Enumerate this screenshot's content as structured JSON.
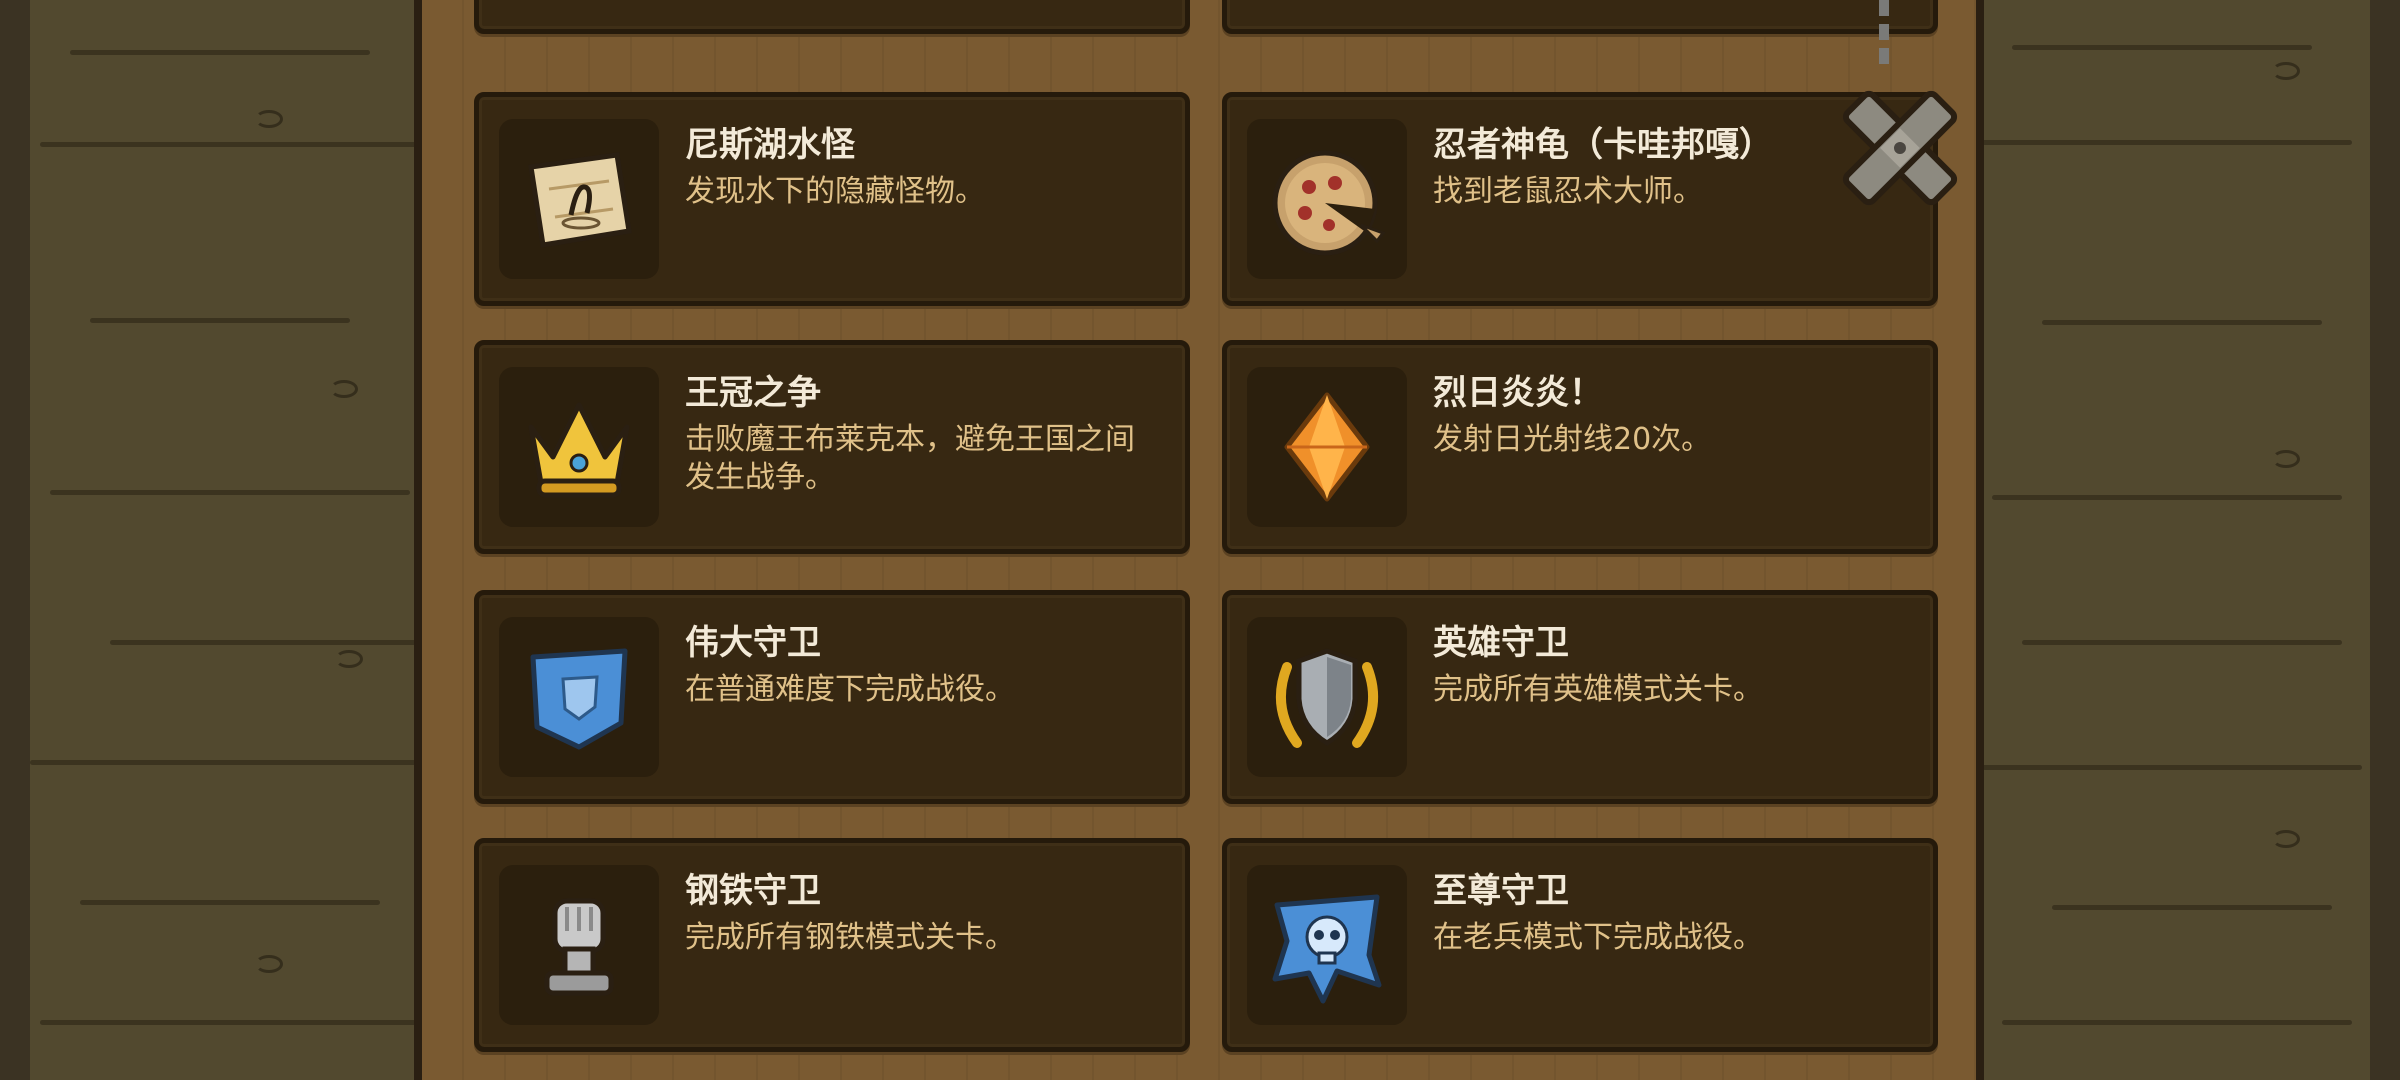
{
  "achievements": [
    {
      "title": "尼斯湖水怪",
      "desc": "发现水下的隐藏怪物。",
      "icon": "lake-map-icon"
    },
    {
      "title": "忍者神龟（卡哇邦嘎）",
      "desc": "找到老鼠忍术大师。",
      "icon": "pizza-icon"
    },
    {
      "title": "王冠之争",
      "desc": "击败魔王布莱克本，避免王国之间发生战争。",
      "icon": "crown-icon"
    },
    {
      "title": "烈日炎炎！",
      "desc": "发射日光射线20次。",
      "icon": "orange-gem-icon"
    },
    {
      "title": "伟大守卫",
      "desc": "在普通难度下完成战役。",
      "icon": "blue-banner-icon"
    },
    {
      "title": "英雄守卫",
      "desc": "完成所有英雄模式关卡。",
      "icon": "laurel-shield-icon"
    },
    {
      "title": "钢铁守卫",
      "desc": "完成所有钢铁模式关卡。",
      "icon": "iron-fist-icon"
    },
    {
      "title": "至尊守卫",
      "desc": "在老兵模式下完成战役。",
      "icon": "skull-banner-icon"
    }
  ],
  "close_button": {
    "icon": "close-x-icon"
  },
  "colors": {
    "title": "#f3ead8",
    "desc": "#e0c189",
    "card": "#372812",
    "frame": "#7a5a31",
    "floor": "#52492f"
  }
}
